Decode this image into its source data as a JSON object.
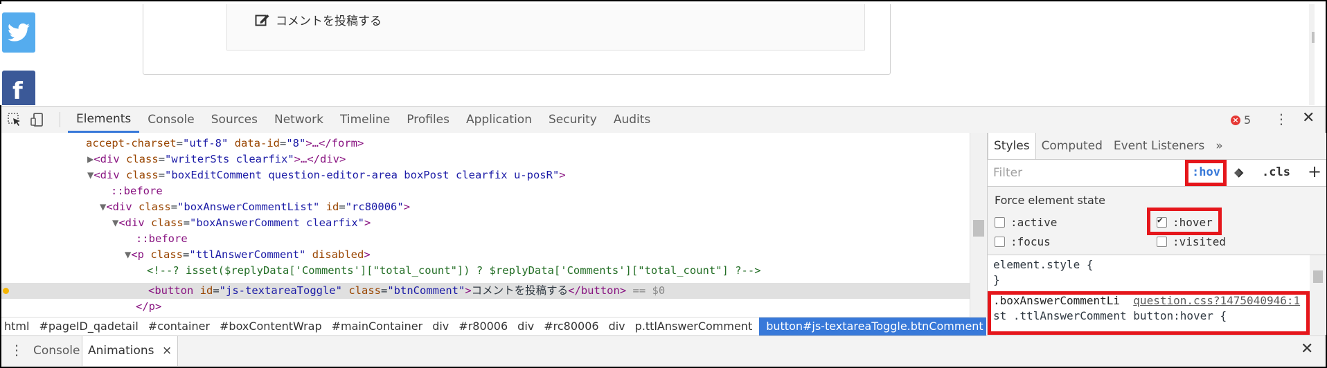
{
  "page": {
    "comment_button": "コメントを投稿する"
  },
  "toolbar": {
    "tabs": [
      "Elements",
      "Console",
      "Sources",
      "Network",
      "Timeline",
      "Profiles",
      "Application",
      "Security",
      "Audits"
    ],
    "error_count": "5"
  },
  "tree": {
    "l1_an": "accept-charset",
    "l1_av": "\"utf-8\"",
    "l1_an2": "data-id",
    "l1_av2": "\"8\"",
    "l1_rest": ">…</form>",
    "l2_an": "class",
    "l2_av": "\"writerSts clearfix\"",
    "l3_an": "class",
    "l3_av": "\"boxEditComment question-editor-area boxPost clearfix u-posR\"",
    "l4_ps": "::before",
    "l5_an": "class",
    "l5_av": "\"boxAnswerCommentList\"",
    "l5_an2": "id",
    "l5_av2": "\"rc80006\"",
    "l6_an": "class",
    "l6_av": "\"boxAnswerComment clearfix\"",
    "l7_ps": "::before",
    "l8_an": "class",
    "l8_av": "\"ttlAnswerComment\"",
    "l8_an2": "disabled",
    "l9_cm": "<!--? isset($replyData['Comments'][\"total_count\"]) ? $replyData['Comments'][\"total_count\"] ?-->",
    "l10_an": "id",
    "l10_av": "\"js-textareaToggle\"",
    "l10_an2": "class",
    "l10_av2": "\"btnComment\"",
    "l10_text": "コメントを投稿する",
    "l10_eq": " == $0",
    "l11": "</p>"
  },
  "breadcrumb": [
    "html",
    "#pageID_qadetail",
    "#container",
    "#boxContentWrap",
    "#mainContainer",
    "div",
    "#r80006",
    "div",
    "#rc80006",
    "div",
    "p.ttlAnswerComment",
    "button#js-textareaToggle.btnComment"
  ],
  "styles": {
    "tabs": [
      "Styles",
      "Computed",
      "Event Listeners"
    ],
    "more": "»",
    "filter_placeholder": "Filter",
    "hov": ":hov",
    "cls": ".cls",
    "plus": "+",
    "force_title": "Force element state",
    "states": [
      ":active",
      ":hover",
      ":focus",
      ":visited"
    ],
    "element_style_open": "element.style {",
    "element_style_close": "}",
    "rule_sel1": ".boxAnswerCommentLi",
    "rule_src": "question.css?1475040946:1",
    "rule_sel2": "st .ttlAnswerComment button:hover {"
  },
  "drawer": {
    "tabs": [
      "Console",
      "Animations"
    ],
    "close": "×"
  }
}
